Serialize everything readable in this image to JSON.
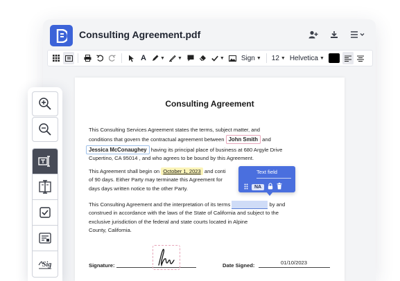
{
  "app": {
    "file_name": "Consulting Agreement.pdf",
    "brand_color": "#3c63d8"
  },
  "title_actions": [
    "add-user-icon",
    "download-icon",
    "menu-icon"
  ],
  "toolbar": {
    "sign_label": "Sign",
    "font_size": "12",
    "font_family": "Helvetica",
    "text_color": "#000000"
  },
  "rail": {
    "tools": [
      "zoom-in",
      "zoom-out",
      "text-field",
      "text-cursor",
      "checkbox",
      "form",
      "signature"
    ],
    "selected": "text-field"
  },
  "document": {
    "title": "Consulting Agreement",
    "p1_a": "This Consulting Services Agreement states the terms, subject matter,  and",
    "p1_b": "conditions that govern the contractual agreement between",
    "party_a": "John Smith",
    "p1_c": "and",
    "party_b": "Jessica McConaughey",
    "p1_d": "having its principal place of business at 680 Argyle Drive",
    "p1_e": "Cupertino, CA 95014 , and who agrees to be bound by this Agreement.",
    "p2_a": "This Agreement shall begin on",
    "start_date": "October 1, 2023",
    "p2_b": "and conti",
    "p2_c": "of 90 days. Either Party may terminate this Agreement for",
    "p2_d": "days days written notice to the other Party.",
    "p3_a": "This Consulting Agreement and the interpretation of its terms",
    "p3_b": "by and",
    "p3_c": "construed in accordance with the laws of the State of California and subject to the",
    "p3_d": "exclusive jurisdiction of the federal and state courts located in Alpine",
    "p3_e": "County, California.",
    "signature_label": "Signature:",
    "date_signed_label": "Date Signed:",
    "date_signed_value": "01/10/2023"
  },
  "popover": {
    "title": "Text field",
    "badge": "NA",
    "color": "#4a6fde"
  }
}
